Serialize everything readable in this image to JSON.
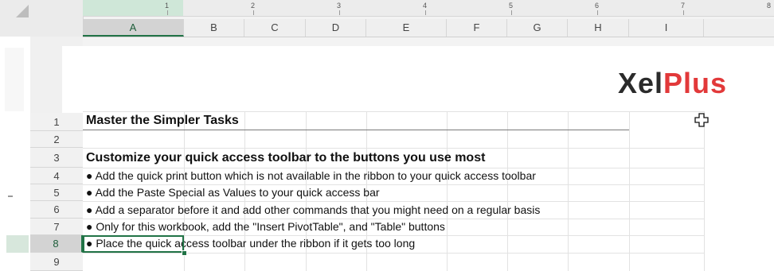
{
  "ruler": {
    "numbers": [
      "1",
      "2",
      "3",
      "4",
      "5",
      "6",
      "7",
      "8"
    ]
  },
  "columns": [
    "A",
    "B",
    "C",
    "D",
    "E",
    "F",
    "G",
    "H",
    "I"
  ],
  "rows": [
    "1",
    "2",
    "3",
    "4",
    "5",
    "6",
    "7",
    "8",
    "9"
  ],
  "selected_cell": {
    "column": "A",
    "row": "8"
  },
  "cells": {
    "r1": "Master the Simpler Tasks",
    "r3": "Customize your quick access toolbar to the buttons you use most",
    "r4": "● Add the quick print button which is not available in the ribbon to your quick access toolbar",
    "r5": "● Add the Paste Special as Values to your quick access bar",
    "r6": "● Add a separator before it and add other commands that you might need on a regular basis",
    "r7": "● Only for this workbook, add the \"Insert PivotTable\", and \"Table\" buttons",
    "r8": "● Place the quick access toolbar under the ribbon if it gets too long"
  },
  "logo": {
    "part1": "Xel",
    "part2": "Plus"
  },
  "colors": {
    "accent": "#217346",
    "logo_dark": "#2b2b2b",
    "logo_red": "#e2393a"
  },
  "icons": {
    "cursor": "move-cross-cursor-icon"
  }
}
